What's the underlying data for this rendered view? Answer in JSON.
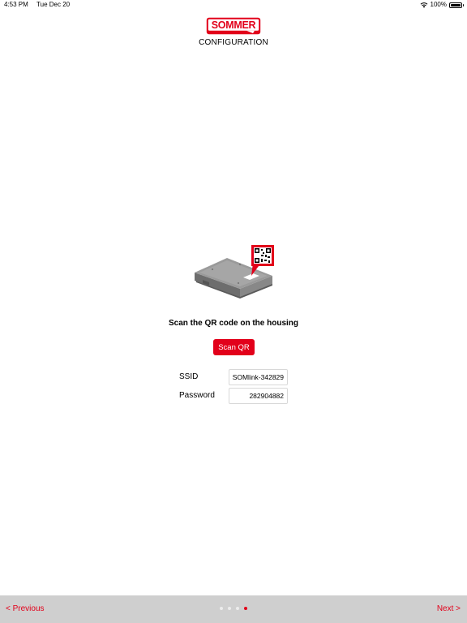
{
  "status_bar": {
    "time": "4:53 PM",
    "date": "Tue Dec 20",
    "battery": "100%",
    "battery_level": 1.0
  },
  "header": {
    "logo_text": "SOMMER",
    "title": "CONFIGURATION"
  },
  "main": {
    "instruction": "Scan the QR code on the housing",
    "scan_button_label": "Scan QR",
    "fields": [
      {
        "label": "SSID",
        "value": "SOMlink-342829"
      },
      {
        "label": "Password",
        "value": "282904882"
      }
    ]
  },
  "footer": {
    "previous_label": "< Previous",
    "next_label": "Next >",
    "page_count": 4,
    "current_page": 4
  },
  "colors": {
    "accent": "#e2001a",
    "footer_bg": "#cfcfcf",
    "dot_inactive": "#ececec"
  },
  "icons": [
    "wifi-icon",
    "battery-icon",
    "qr-code-icon"
  ]
}
